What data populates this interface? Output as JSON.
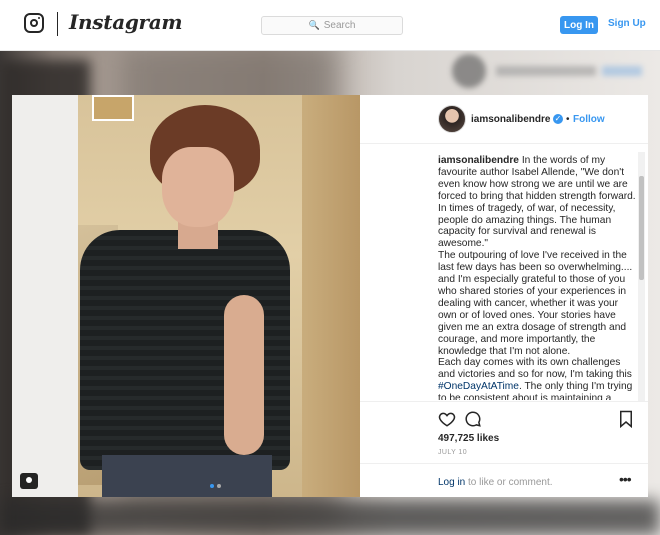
{
  "nav": {
    "wordmark": "Instagram",
    "search_placeholder": "Search",
    "login_label": "Log In",
    "signup_label": "Sign Up",
    "accent_color": "#3897f0"
  },
  "post": {
    "username": "iamsonalibendre",
    "follow_label": "Follow",
    "separator": "•",
    "caption": {
      "username": "iamsonalibendre",
      "intro": "In the words of my favourite author Isabel Allende, \"We don't even know how strong we are until we are forced to bring that hidden strength forward. In times of tragedy, of war, of necessity, people do amazing things. The human capacity for survival and renewal is awesome.\"",
      "para2": "The outpouring of love I've received in the last few days has been so overwhelming.... and I'm especially grateful to those of you who shared stories of your experiences in dealing with cancer, whether it was your own or of loved ones. Your stories have given me an extra dosage of strength and courage, and more importantly, the knowledge that I'm not alone.",
      "para3_before": "Each day comes with its own challenges and victories and so for now, I'm taking this",
      "hashtag": "#OneDayAtATime",
      "para3_after": ". The only thing I'm trying to be consistent about is maintaining a"
    },
    "likes": "497,725 likes",
    "date": "JULY 10",
    "login_link": "Log in",
    "login_rest": " to like or comment.",
    "more_glyph": "•••",
    "carousel_active_index": 0,
    "carousel_count": 2
  }
}
